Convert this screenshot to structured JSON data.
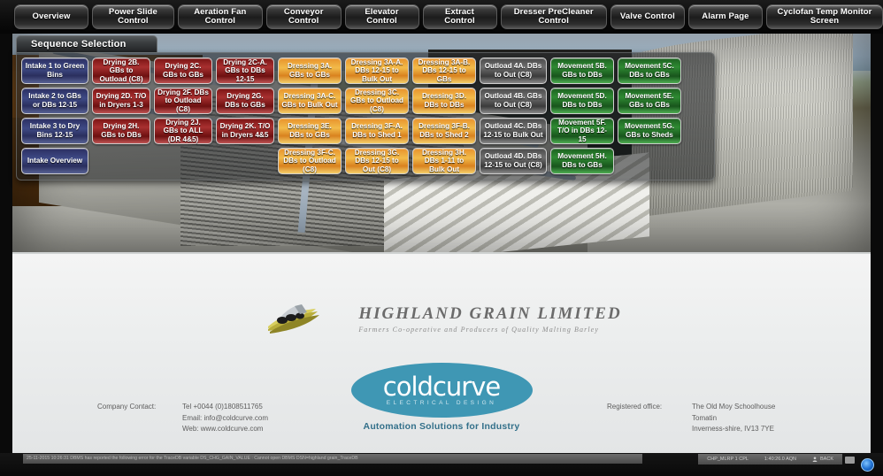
{
  "navbar": {
    "tabs": [
      {
        "label": "Overview",
        "name": "tab-overview"
      },
      {
        "label": "Power Slide Control",
        "name": "tab-power-slide-control"
      },
      {
        "label": "Aeration Fan Control",
        "name": "tab-aeration-fan-control"
      },
      {
        "label": "Conveyor Control",
        "name": "tab-conveyor-control"
      },
      {
        "label": "Elevator Control",
        "name": "tab-elevator-control"
      },
      {
        "label": "Extract Control",
        "name": "tab-extract-control"
      },
      {
        "label": "Dresser PreCleaner Control",
        "name": "tab-dresser-precleaner-control"
      },
      {
        "label": "Valve Control",
        "name": "tab-valve-control"
      },
      {
        "label": "Alarm Page",
        "name": "tab-alarm-page"
      },
      {
        "label": "Cyclofan Temp Monitor Screen",
        "name": "tab-cyclofan-temp-monitor-screen"
      }
    ],
    "close_label": "✕"
  },
  "sequence_panel": {
    "header": "Sequence Selection",
    "columns": [
      {
        "family": "intake",
        "color": "#2f3a72",
        "buttons": [
          "Intake 1 to Green Bins",
          "Intake 2 to GBs or DBs 12-15",
          "Intake 3 to Dry Bins 12-15",
          "Intake Overview"
        ]
      },
      {
        "family": "drying",
        "color": "#8d1f1f",
        "buttons": [
          "Drying 2B. GBs to Outload (C8)",
          "Drying 2D. T/O in Dryers 1-3",
          "Drying 2H. GBs to DBs"
        ]
      },
      {
        "family": "drying",
        "color": "#8d1f1f",
        "buttons": [
          "Drying 2C. GBs to GBs",
          "Drying 2F. DBs to Outload (C8)",
          "Drying 2J. GBs to ALL (DR 4&5)"
        ]
      },
      {
        "family": "drying",
        "color": "#8d1f1f",
        "buttons": [
          "Drying 2C-A. GBs to DBs 12-15",
          "Drying 2G. DBs to GBs",
          "Drying 2K. T/O in Dryers 4&5"
        ]
      },
      {
        "family": "dressing",
        "color": "#e8a23a",
        "buttons": [
          "Dressing 3A. GBs to GBs",
          "Dressing 3A-C. GBs to Bulk Out",
          "Dressing 3E. DBs to GBs",
          "Dressing 3F-C. DBs to Outload (C8)"
        ]
      },
      {
        "family": "dressing",
        "color": "#e8a23a",
        "buttons": [
          "Dressing 3A-A. DBs 12-15 to Bulk Out",
          "Dressing 3C. GBs to Outload (C8)",
          "Dressing 3F-A. DBs to Shed 1",
          "Dressing 3G. DBs 12-15 to Out (C8)"
        ]
      },
      {
        "family": "dressing",
        "color": "#e8a23a",
        "buttons": [
          "Dressing 3A-B. DBs 12-15 to GBs",
          "Dressing 3D. DBs to DBs",
          "Dressing 3F-B. DBs to Shed 2",
          "Dressing 3H. DBs 1-11 to Bulk Out"
        ]
      },
      {
        "family": "outload",
        "color": "#5a5a5a",
        "buttons": [
          "Outload 4A. DBs to Out (C8)",
          "Outload 4B. GBs to Out (C8)",
          "Outload 4C. DBs 12-15 to Bulk Out",
          "Outload 4D. DBs 12-15 to Out (C8)"
        ]
      },
      {
        "family": "movement",
        "color": "#2b8a30",
        "buttons": [
          "Movement 5B. GBs to DBs",
          "Movement 5D. DBs to DBs",
          "Movement 5F. T/O in DBs 12-15",
          "Movement 5H. DBs to GBs"
        ]
      },
      {
        "family": "movement",
        "color": "#2b8a30",
        "buttons": [
          "Movement 5C. DBs to GBs",
          "Movement 5E. GBs to GBs",
          "Movement 5G. GBs to Sheds"
        ]
      }
    ]
  },
  "branding": {
    "highland_title": "HIGHLAND GRAIN LIMITED",
    "highland_subtitle": "Farmers Co-operative and Producers of Quality Malting Barley",
    "coldcurve_word": "coldcurve",
    "coldcurve_elec": "ELECTRICAL DESIGN",
    "coldcurve_tagline": "Automation Solutions for Industry",
    "contact": {
      "label": "Company Contact:",
      "tel": "Tel +0044 (0)1808511765",
      "email": "Email: info@coldcurve.com",
      "web": "Web: www.coldcurve.com"
    },
    "registered": {
      "label": "Registered office:",
      "line1": "The Old Moy Schoolhouse",
      "line2": "Tomatin",
      "line3": "Inverness-shire, IV13 7YE"
    }
  },
  "statusbar": {
    "message": "25-11-2015 10:26:31 DBMS has reported the following error for the TraceDB variable  DS_CHG_GAIN_VALUE  :  Cannot open DBMS DSN=highland grain_TraceDB",
    "indicators": [
      {
        "label": "CHP_MLRP 1 CPL"
      },
      {
        "label": "1:40:26.0 AQN"
      },
      {
        "label": "BACK"
      }
    ]
  }
}
